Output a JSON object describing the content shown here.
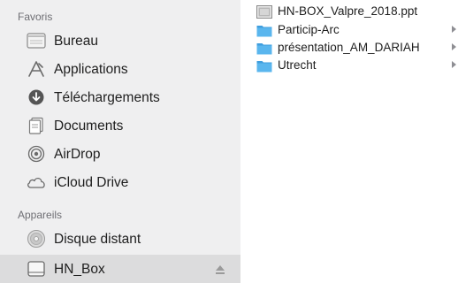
{
  "sidebar": {
    "favorites_header": "Favoris",
    "devices_header": "Appareils",
    "favorites": [
      {
        "label": "Bureau",
        "icon": "desktop-icon"
      },
      {
        "label": "Applications",
        "icon": "applications-icon"
      },
      {
        "label": "Téléchargements",
        "icon": "downloads-icon"
      },
      {
        "label": "Documents",
        "icon": "documents-icon"
      },
      {
        "label": "AirDrop",
        "icon": "airdrop-icon"
      },
      {
        "label": "iCloud Drive",
        "icon": "icloud-icon"
      }
    ],
    "devices": [
      {
        "label": "Disque distant",
        "icon": "remote-disc-icon"
      },
      {
        "label": "HN_Box",
        "icon": "drive-icon",
        "selected": true,
        "eject": "eject-icon"
      }
    ]
  },
  "files": [
    {
      "name": "HN-BOX_Valpre_2018.ppt",
      "type": "file",
      "icon": "presentation-file-icon"
    },
    {
      "name": "Particip-Arc",
      "type": "folder",
      "icon": "folder-icon"
    },
    {
      "name": "présentation_AM_DARIAH",
      "type": "folder",
      "icon": "folder-icon"
    },
    {
      "name": "Utrecht",
      "type": "folder",
      "icon": "folder-icon"
    }
  ],
  "colors": {
    "sidebar_bg": "#efeff0",
    "selected_bg": "#dcdcdd",
    "folder_blue": "#5ab6ee",
    "section_header": "#6e6e73"
  }
}
